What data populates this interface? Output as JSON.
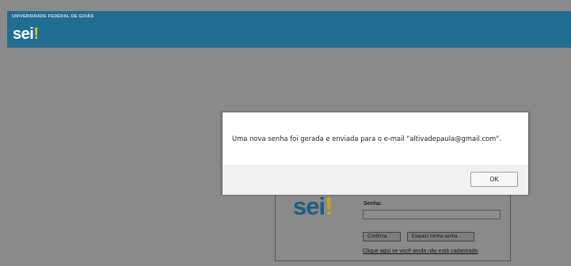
{
  "header": {
    "institution": "UNIVERSIDADE FEDERAL DE GOIÁS",
    "logo_text": "sei",
    "logo_mark": "!",
    "brand_color": "#1f6d91"
  },
  "login": {
    "logo_text": "sei",
    "logo_mark": "!",
    "password_label": "Senha:",
    "password_value": "",
    "confirm_label": "Confirma",
    "forgot_label": "Esqueci minha senha",
    "register_link": "Clique aqui se você ainda não está cadastrado"
  },
  "dialog": {
    "message": "Uma nova senha foi gerada e enviada para o e-mail \"altivadepaula@gmail.com\".",
    "ok_label": "OK"
  }
}
